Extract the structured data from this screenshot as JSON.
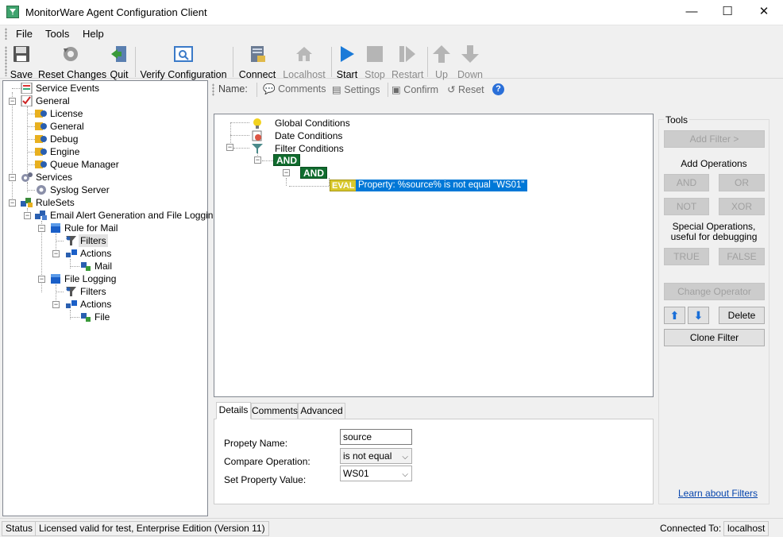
{
  "window": {
    "title": "MonitorWare Agent Configuration Client",
    "minimize": "—",
    "maximize": "☐",
    "close": "✕"
  },
  "menu": {
    "file": "File",
    "tools": "Tools",
    "help": "Help"
  },
  "toolbar": {
    "save": "Save",
    "reset_changes": "Reset Changes",
    "quit": "Quit",
    "verify": "Verify Configuration",
    "connect": "Connect",
    "localhost": "Localhost",
    "start": "Start",
    "stop": "Stop",
    "restart": "Restart",
    "up": "Up",
    "down": "Down"
  },
  "tree": {
    "service_events": "Service Events",
    "general": "General",
    "license": "License",
    "general_child": "General",
    "debug": "Debug",
    "engine": "Engine",
    "queue_manager": "Queue Manager",
    "services": "Services",
    "syslog_server": "Syslog Server",
    "rulesets": "RuleSets",
    "email_alert": "Email Alert Generation and File Logging",
    "rule_for_mail": "Rule for Mail",
    "filters1": "Filters",
    "actions1": "Actions",
    "mail": "Mail",
    "file_logging": "File Logging",
    "filters2": "Filters",
    "actions2": "Actions",
    "file": "File"
  },
  "subtoolbar": {
    "name": "Name:",
    "comments": "Comments",
    "settings": "Settings",
    "confirm": "Confirm",
    "reset": "Reset"
  },
  "filter_tree": {
    "global_conditions": "Global Conditions",
    "date_conditions": "Date Conditions",
    "filter_conditions": "Filter Conditions",
    "and1": "AND",
    "and2": "AND",
    "eval": "EVAL",
    "eval_text": "Property: %source% is not equal \"WS01\""
  },
  "details": {
    "tabs": [
      "Details",
      "Comments",
      "Advanced"
    ],
    "property_name_label": "Propety Name:",
    "property_name_value": "source",
    "compare_op_label": "Compare Operation:",
    "compare_op_value": "is not equal",
    "set_value_label": "Set Property Value:",
    "set_value_value": "WS01"
  },
  "tools": {
    "title": "Tools",
    "add_filter": "Add Filter >",
    "add_operations": "Add Operations",
    "and": "AND",
    "or": "OR",
    "not": "NOT",
    "xor": "XOR",
    "special_ops_line1": "Special Operations,",
    "special_ops_line2": "useful for debugging",
    "true": "TRUE",
    "false": "FALSE",
    "change_operator": "Change Operator",
    "delete": "Delete",
    "clone_filter": "Clone Filter",
    "learn": "Learn about Filters"
  },
  "status": {
    "label": "Status",
    "license": "Licensed valid for test, Enterprise Edition (Version 11)",
    "connected_label": "Connected To:",
    "connected_value": "localhost"
  },
  "colors": {
    "accent_blue": "#0078d7",
    "and_green": "#106c2e",
    "eval_yellow": "#d8c82c"
  }
}
